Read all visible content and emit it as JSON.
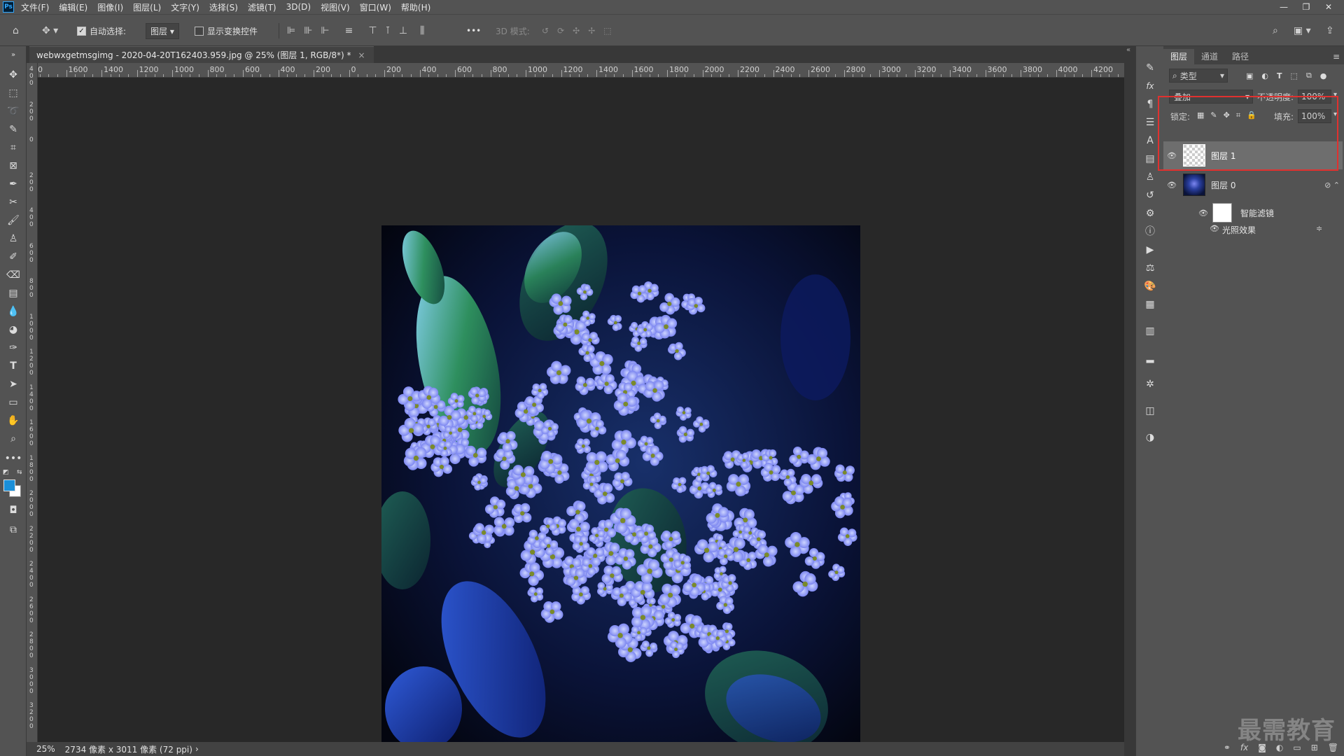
{
  "app": {
    "logo": "Ps",
    "menu": [
      "文件(F)",
      "编辑(E)",
      "图像(I)",
      "图层(L)",
      "文字(Y)",
      "选择(S)",
      "滤镜(T)",
      "3D(D)",
      "视图(V)",
      "窗口(W)",
      "帮助(H)"
    ],
    "window_controls": [
      "—",
      "❐",
      "✕"
    ]
  },
  "options_bar": {
    "auto_select_label": "自动选择:",
    "auto_select_checked": true,
    "auto_select_target": "图层",
    "show_transform_label": "显示变换控件",
    "show_transform_checked": false,
    "more": "•••",
    "mode_3d_label": "3D 模式:"
  },
  "document": {
    "tab_title": "webwxgetmsgimg - 2020-04-20T162403.959.jpg @ 25% (图层 1, RGB/8*) *",
    "close": "×"
  },
  "ruler": {
    "h_labels": [
      "00",
      "1600",
      "1400",
      "1200",
      "1000",
      "800",
      "600",
      "400",
      "200",
      "0",
      "200",
      "400",
      "600",
      "800",
      "1000",
      "1200",
      "1400",
      "1600",
      "1800",
      "2000",
      "2200",
      "2400",
      "2600",
      "2800",
      "3000",
      "3200",
      "3400",
      "3600",
      "3800",
      "4000",
      "4200",
      "44"
    ],
    "v_labels": [
      "400",
      "200",
      "0",
      "200",
      "400",
      "600",
      "800",
      "1000",
      "1200",
      "1400",
      "1600",
      "1800",
      "2000",
      "2200",
      "2400",
      "2600",
      "2800",
      "3000",
      "3200"
    ]
  },
  "status": {
    "zoom": "25%",
    "dimensions": "2734 像素 x 3011 像素 (72 ppi)",
    "arrow": "›"
  },
  "layers_panel": {
    "tabs": [
      "图层",
      "通道",
      "路径"
    ],
    "active_tab": 0,
    "filter_kind": "类型",
    "blend_mode": "叠加",
    "opacity_label": "不透明度:",
    "opacity_value": "100%",
    "lock_label": "锁定:",
    "fill_label": "填充:",
    "fill_value": "100%",
    "layers": [
      {
        "name": "图层 1",
        "visible": true,
        "selected": true
      },
      {
        "name": "图层 0",
        "visible": true,
        "selected": false
      }
    ],
    "smart_filters_label": "智能滤镜",
    "filter_effect": "光照效果"
  },
  "watermark": "最需教育",
  "colors": {
    "foreground": "#1a8fd8",
    "background": "#ffffff",
    "highlight_box": "#e0312f"
  }
}
